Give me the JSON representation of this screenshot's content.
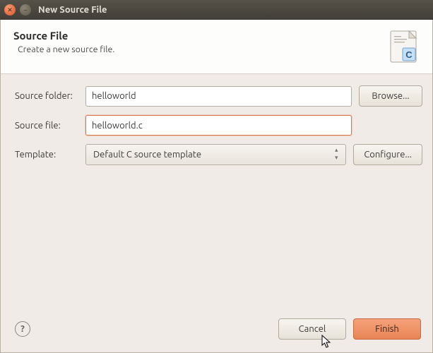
{
  "titlebar": {
    "title": "New Source File"
  },
  "header": {
    "title": "Source File",
    "subtitle": "Create a new source file."
  },
  "form": {
    "source_folder_label": "Source folder:",
    "source_folder_value": "helloworld",
    "browse_label": "Browse...",
    "source_file_label": "Source file:",
    "source_file_value": "helloworld.c",
    "template_label": "Template:",
    "template_value": "Default C source template",
    "configure_label": "Configure..."
  },
  "footer": {
    "help_glyph": "?",
    "cancel_label": "Cancel",
    "finish_label": "Finish"
  }
}
